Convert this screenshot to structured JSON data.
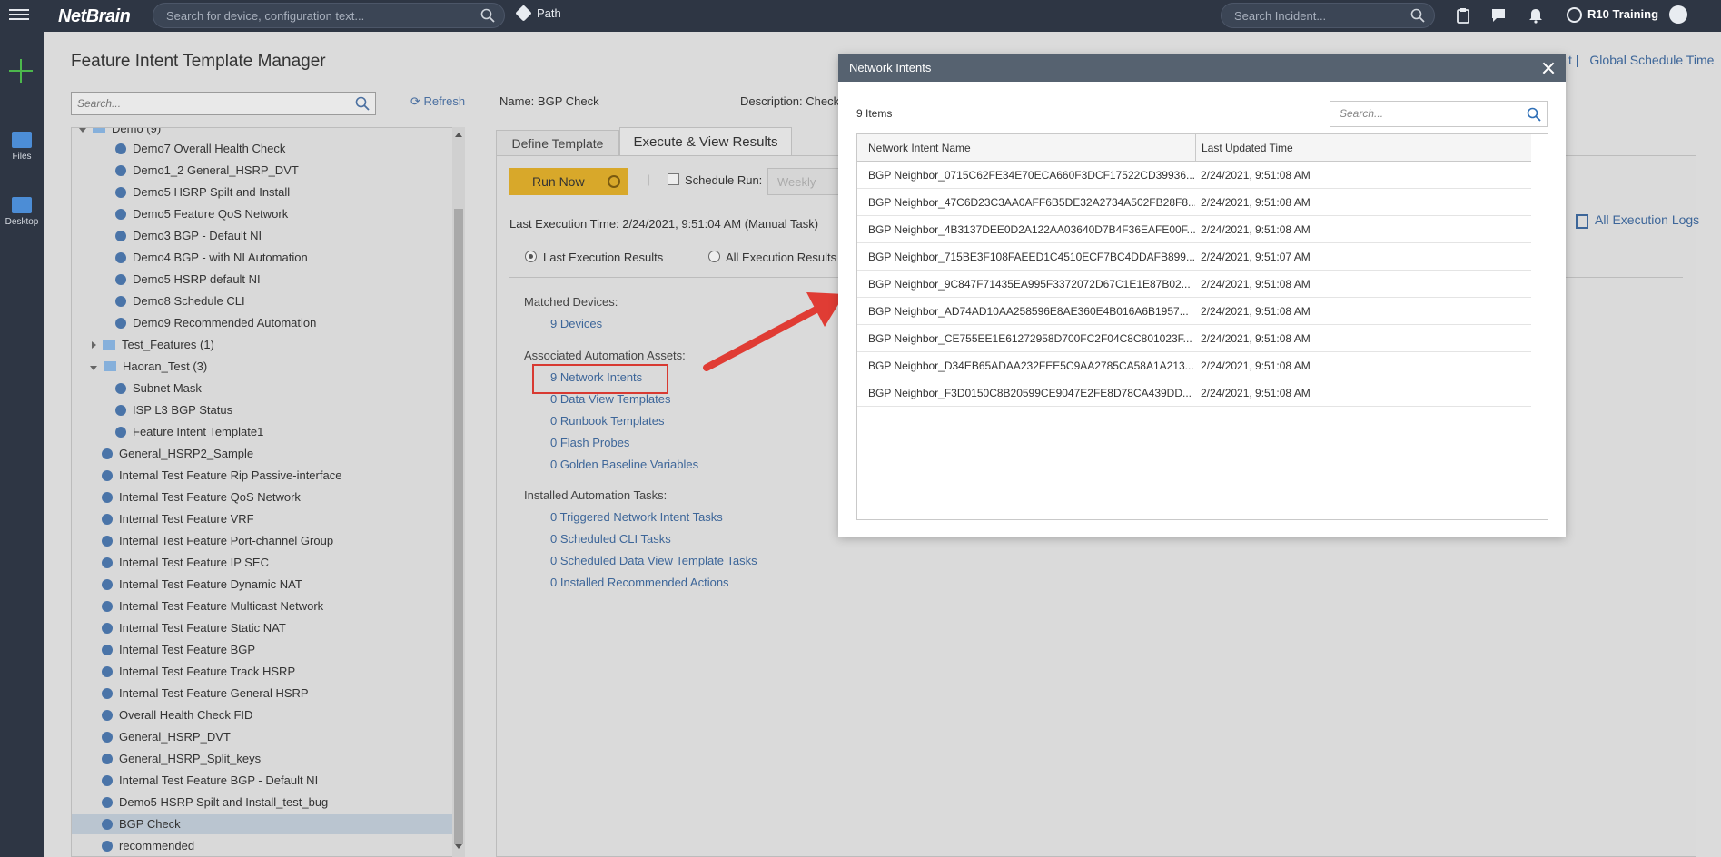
{
  "topbar": {
    "logo": "NetBrain",
    "search_placeholder": "Search for device, configuration text...",
    "path_label": "Path",
    "incident_placeholder": "Search Incident...",
    "user_label": "R10 Training"
  },
  "rail": {
    "files_label": "Files",
    "desktop_label": "Desktop"
  },
  "page": {
    "title": "Feature Intent Template Manager",
    "search_placeholder": "Search...",
    "refresh_label": "Refresh",
    "name_label": "Name:",
    "name_value": "BGP Check",
    "description_label": "Description:",
    "description_value": "Check",
    "global_schedule": "Global Schedule Time",
    "global_schedule_prefix": "t  |"
  },
  "tree": {
    "items": [
      {
        "label": "Demo (9)",
        "kind": "folder"
      },
      {
        "label": "Demo7 Overall Health Check",
        "kind": "leaf"
      },
      {
        "label": "Demo1_2 General_HSRP_DVT",
        "kind": "leaf"
      },
      {
        "label": "Demo5 HSRP Spilt and Install",
        "kind": "leaf"
      },
      {
        "label": "Demo5 Feature QoS Network",
        "kind": "leaf"
      },
      {
        "label": "Demo3 BGP - Default NI",
        "kind": "leaf"
      },
      {
        "label": "Demo4 BGP - with NI Automation",
        "kind": "leaf"
      },
      {
        "label": "Demo5 HSRP default NI",
        "kind": "leaf"
      },
      {
        "label": "Demo8 Schedule CLI",
        "kind": "leaf"
      },
      {
        "label": "Demo9 Recommended Automation",
        "kind": "leaf"
      },
      {
        "label": "Test_Features (1)",
        "kind": "folder-closed"
      },
      {
        "label": "Haoran_Test (3)",
        "kind": "folder-open"
      },
      {
        "label": "Subnet Mask",
        "kind": "leaf"
      },
      {
        "label": "ISP L3 BGP Status",
        "kind": "leaf"
      },
      {
        "label": "Feature Intent Template1",
        "kind": "leaf"
      },
      {
        "label": "General_HSRP2_Sample",
        "kind": "root-leaf"
      },
      {
        "label": "Internal Test Feature Rip Passive-interface",
        "kind": "root-leaf"
      },
      {
        "label": "Internal Test Feature QoS Network",
        "kind": "root-leaf"
      },
      {
        "label": "Internal Test Feature VRF",
        "kind": "root-leaf"
      },
      {
        "label": "Internal Test Feature Port-channel Group",
        "kind": "root-leaf"
      },
      {
        "label": "Internal Test Feature IP SEC",
        "kind": "root-leaf"
      },
      {
        "label": "Internal Test Feature Dynamic NAT",
        "kind": "root-leaf"
      },
      {
        "label": "Internal Test Feature Multicast Network",
        "kind": "root-leaf"
      },
      {
        "label": "Internal Test Feature Static NAT",
        "kind": "root-leaf"
      },
      {
        "label": "Internal Test Feature BGP",
        "kind": "root-leaf"
      },
      {
        "label": "Internal Test Feature Track HSRP",
        "kind": "root-leaf"
      },
      {
        "label": "Internal Test Feature General HSRP",
        "kind": "root-leaf"
      },
      {
        "label": "Overall Health Check FID",
        "kind": "root-leaf"
      },
      {
        "label": "General_HSRP_DVT",
        "kind": "root-leaf"
      },
      {
        "label": "General_HSRP_Split_keys",
        "kind": "root-leaf"
      },
      {
        "label": "Internal Test Feature BGP - Default NI",
        "kind": "root-leaf"
      },
      {
        "label": "Demo5 HSRP Spilt and Install_test_bug",
        "kind": "root-leaf"
      },
      {
        "label": "BGP Check",
        "kind": "root-leaf-selected"
      },
      {
        "label": "recommended",
        "kind": "root-leaf"
      }
    ]
  },
  "tabs": {
    "define": "Define Template",
    "execute": "Execute & View Results"
  },
  "execute": {
    "run_now": "Run Now",
    "separator": "|",
    "schedule_label": "Schedule Run:",
    "weekly": "Weekly",
    "last_execution": "Last Execution Time: 2/24/2021, 9:51:04 AM (Manual Task)",
    "radio_last": "Last Execution Results",
    "radio_all": "All Execution Results",
    "all_logs": "All Execution Logs",
    "matched_devices_label": "Matched Devices:",
    "matched_devices_link": "9 Devices",
    "assets_label": "Associated Automation Assets:",
    "assets": [
      "9 Network Intents",
      "0 Data View Templates",
      "0 Runbook Templates",
      "0 Flash Probes",
      "0 Golden Baseline Variables"
    ],
    "tasks_label": "Installed Automation Tasks:",
    "tasks": [
      "0 Triggered Network Intent Tasks",
      "0 Scheduled CLI Tasks",
      "0 Scheduled Data View Template Tasks",
      "0 Installed Recommended Actions"
    ]
  },
  "dialog": {
    "title": "Network Intents",
    "items_count": "9 Items",
    "search_placeholder": "Search...",
    "columns": [
      "Network Intent Name",
      "Last Updated Time"
    ],
    "rows": [
      [
        "BGP Neighbor_0715C62FE34E70ECA660F3DCF17522CD39936...",
        "2/24/2021, 9:51:08 AM"
      ],
      [
        "BGP Neighbor_47C6D23C3AA0AFF6B5DE32A2734A502FB28F8...",
        "2/24/2021, 9:51:08 AM"
      ],
      [
        "BGP Neighbor_4B3137DEE0D2A122AA03640D7B4F36EAFE00F...",
        "2/24/2021, 9:51:08 AM"
      ],
      [
        "BGP Neighbor_715BE3F108FAEED1C4510ECF7BC4DDAFB899...",
        "2/24/2021, 9:51:07 AM"
      ],
      [
        "BGP Neighbor_9C847F71435EA995F3372072D67C1E1E87B02...",
        "2/24/2021, 9:51:08 AM"
      ],
      [
        "BGP Neighbor_AD74AD10AA258596E8AE360E4B016A6B1957...",
        "2/24/2021, 9:51:08 AM"
      ],
      [
        "BGP Neighbor_CE755EE1E61272958D700FC2F04C8C801023F...",
        "2/24/2021, 9:51:08 AM"
      ],
      [
        "BGP Neighbor_D34EB65ADAA232FEE5C9AA2785CA58A1A213...",
        "2/24/2021, 9:51:08 AM"
      ],
      [
        "BGP Neighbor_F3D0150C8B20599CE9047E2FE8D78CA439DD...",
        "2/24/2021, 9:51:08 AM"
      ]
    ]
  }
}
